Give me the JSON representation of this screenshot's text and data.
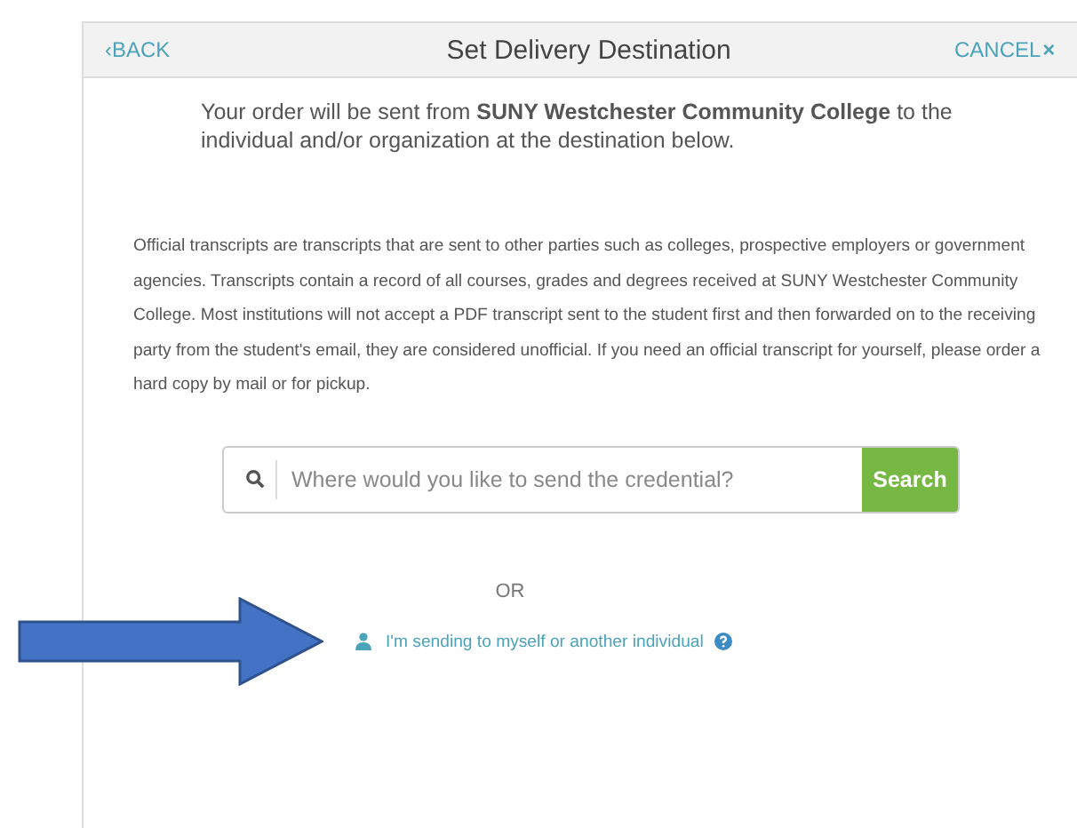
{
  "header": {
    "back": "‹BACK",
    "title": "Set Delivery Destination",
    "cancel": "CANCEL",
    "cancel_mark": "×"
  },
  "intro": "Your order will be sent from **SUNY Westchester Community College** to the individual and/or organization at the destination below.",
  "notice": "Official transcripts are transcripts that are sent to other parties such as colleges, prospective employers or government agencies. Transcripts contain a record of all courses, grades and degrees received at SUNY Westchester Community College. Most institutions will not accept a PDF transcript sent to the student first and then forwarded on to the receiving party from the student's email, they are considered unofficial. If you need an official transcript for yourself, please order a hard copy by mail or for pickup.",
  "search": {
    "placeholder": "Where would you like to send the credential?",
    "button": "Search"
  },
  "separator": "OR",
  "individual_link": "I'm sending to myself or another individual"
}
